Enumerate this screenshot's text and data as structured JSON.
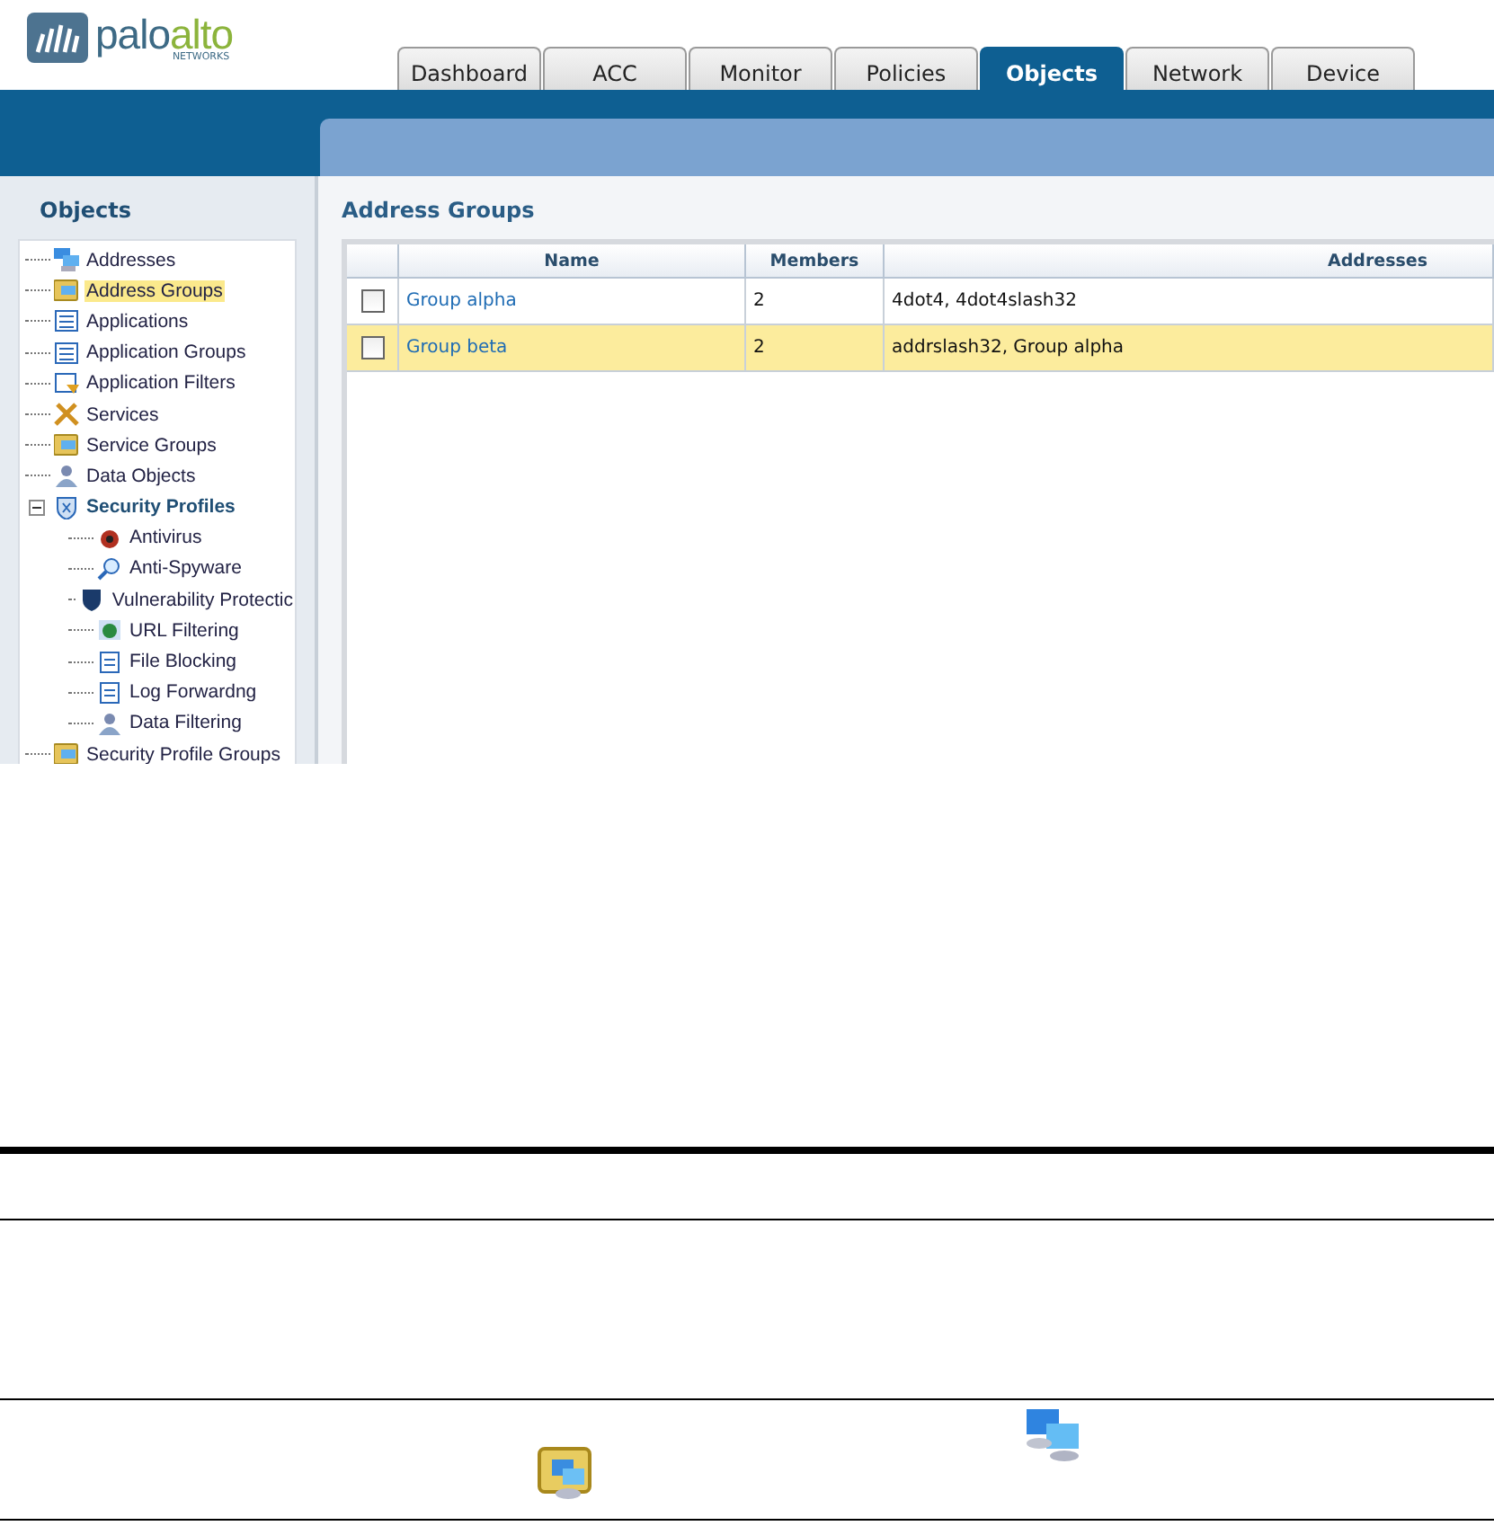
{
  "logo": {
    "first": "palo",
    "second": "alto",
    "sub": "NETWORKS"
  },
  "tabs": [
    {
      "label": "Dashboard",
      "selected": false
    },
    {
      "label": "ACC",
      "selected": false
    },
    {
      "label": "Monitor",
      "selected": false
    },
    {
      "label": "Policies",
      "selected": false
    },
    {
      "label": "Objects",
      "selected": true
    },
    {
      "label": "Network",
      "selected": false
    },
    {
      "label": "Device",
      "selected": false
    }
  ],
  "sidebar": {
    "title": "Objects",
    "items": [
      {
        "label": "Addresses",
        "selected": false
      },
      {
        "label": "Address Groups",
        "selected": true
      },
      {
        "label": "Applications",
        "selected": false
      },
      {
        "label": "Application Groups",
        "selected": false
      },
      {
        "label": "Application Filters",
        "selected": false
      },
      {
        "label": "Services",
        "selected": false
      },
      {
        "label": "Service Groups",
        "selected": false
      },
      {
        "label": "Data Objects",
        "selected": false
      },
      {
        "label": "Security Profiles",
        "selected": false,
        "expanded": true,
        "children": [
          {
            "label": "Antivirus",
            "selected": false
          },
          {
            "label": "Anti-Spyware",
            "selected": false
          },
          {
            "label": "Vulnerability Protectic",
            "selected": false
          },
          {
            "label": "URL Filtering",
            "selected": false
          },
          {
            "label": "File Blocking",
            "selected": false
          },
          {
            "label": "Log Forwardng",
            "selected": false
          },
          {
            "label": "Data Filtering",
            "selected": false
          }
        ]
      },
      {
        "label": "Security Profile Groups",
        "selected": false
      }
    ]
  },
  "main": {
    "title": "Address Groups",
    "table": {
      "columns": [
        "Name",
        "Members",
        "Addresses"
      ],
      "rows": [
        {
          "checked": false,
          "selected": false,
          "cells": [
            "Group alpha",
            "2",
            "4dot4, 4dot4slash32"
          ]
        },
        {
          "checked": false,
          "selected": true,
          "cells": [
            "Group beta",
            "2",
            "addrslash32, Group alpha"
          ]
        }
      ]
    }
  }
}
